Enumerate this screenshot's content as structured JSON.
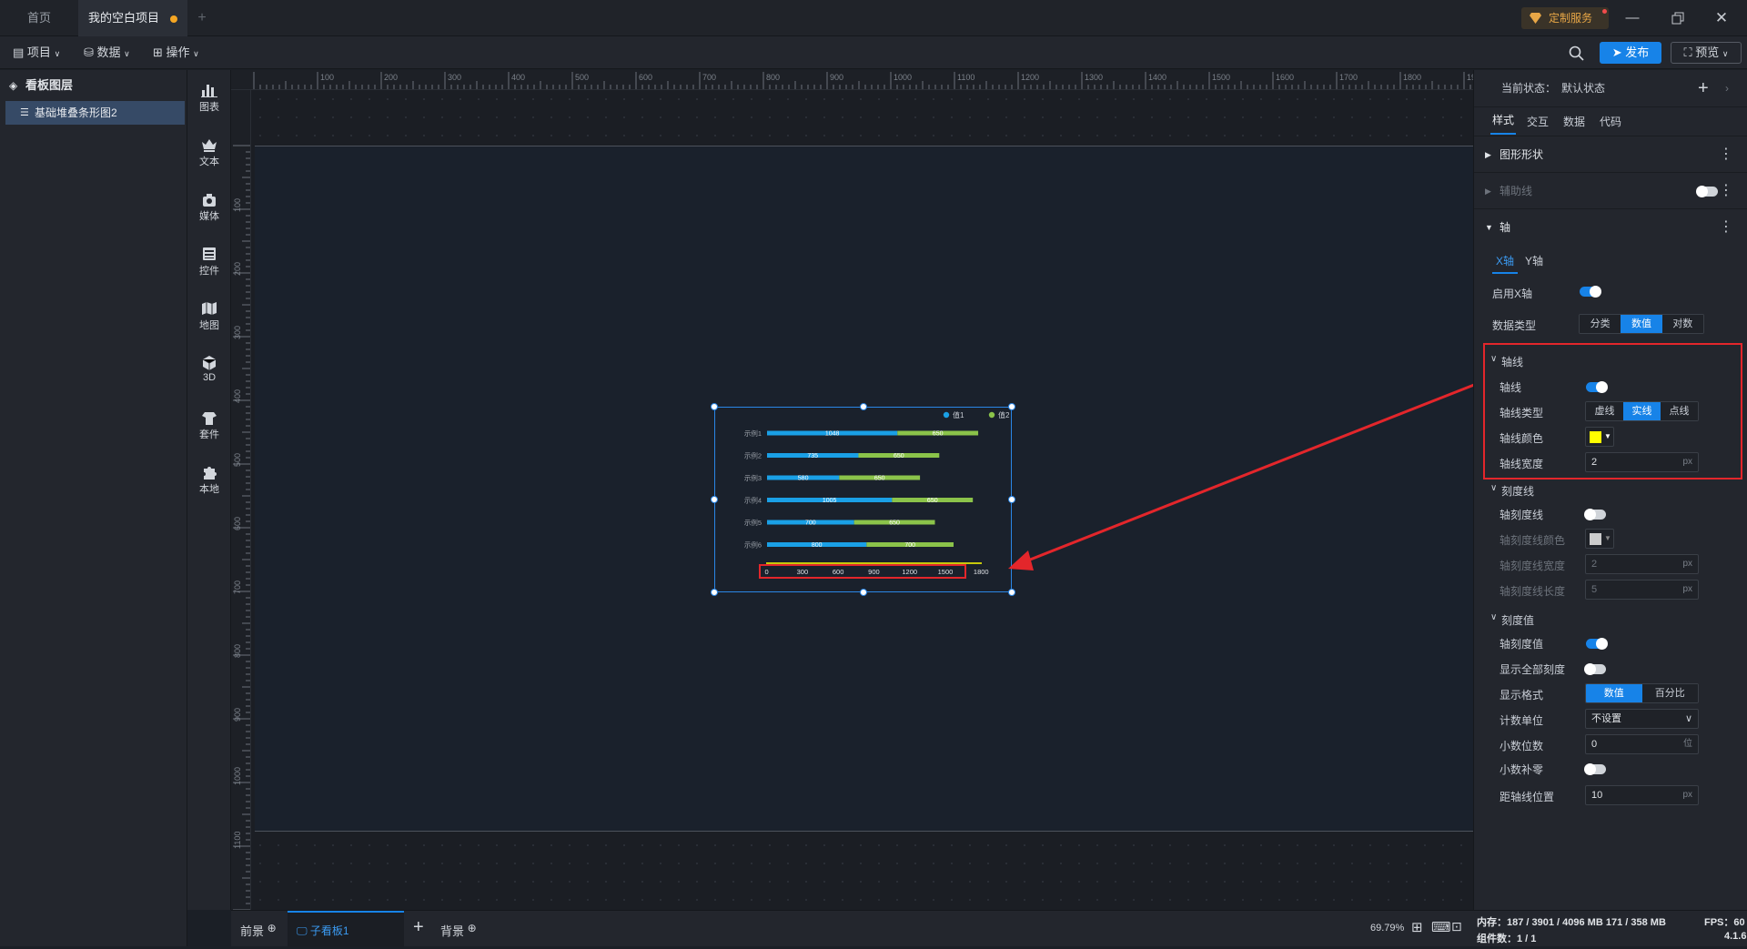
{
  "tabs": [
    {
      "label": "首页"
    },
    {
      "label": "我的空白项目"
    }
  ],
  "top_right": {
    "custom_service": "定制服务"
  },
  "toolbar": {
    "project": "项目",
    "data": "数据",
    "operate": "操作",
    "publish": "发布",
    "preview": "预览"
  },
  "layers": {
    "title": "看板图层",
    "items": [
      {
        "label": "基础堆叠条形图2"
      }
    ]
  },
  "tools": [
    {
      "label": "图表",
      "icon": "bar-chart-icon"
    },
    {
      "label": "文本",
      "icon": "text-icon"
    },
    {
      "label": "媒体",
      "icon": "media-icon"
    },
    {
      "label": "控件",
      "icon": "widget-icon"
    },
    {
      "label": "地图",
      "icon": "map-icon"
    },
    {
      "label": "3D",
      "icon": "cube-icon"
    },
    {
      "label": "套件",
      "icon": "kit-icon"
    },
    {
      "label": "本地",
      "icon": "puzzle-icon"
    }
  ],
  "ruler": {
    "top_ticks": [
      "100",
      "200",
      "300",
      "400",
      "500",
      "600",
      "700",
      "800",
      "900",
      "1000",
      "1100",
      "1200",
      "1300",
      "1400",
      "1500",
      "1600",
      "1700",
      "1800",
      "1900"
    ],
    "left_ticks": [
      "100",
      "200",
      "300",
      "400",
      "500",
      "600",
      "700",
      "800",
      "900",
      "1000",
      "1100"
    ]
  },
  "chart_data": {
    "type": "bar",
    "orientation": "horizontal",
    "stacked": true,
    "categories": [
      "示例1",
      "示例2",
      "示例3",
      "示例4",
      "示例5",
      "示例6"
    ],
    "series": [
      {
        "name": "值1",
        "color": "#1aa0e6",
        "values": [
          1048,
          735,
          580,
          1005,
          700,
          800
        ]
      },
      {
        "name": "值2",
        "color": "#8bc34a",
        "values": [
          650,
          650,
          650,
          650,
          650,
          700
        ]
      }
    ],
    "x_ticks": [
      "0",
      "300",
      "600",
      "900",
      "1200",
      "1500",
      "1800"
    ],
    "xlim": [
      0,
      1800
    ],
    "axis_line_color": "#ffff00",
    "legend": "top-right"
  },
  "props": {
    "state_label": "当前状态：",
    "state_value": "默认状态",
    "tabs": [
      "样式",
      "交互",
      "数据",
      "代码"
    ],
    "sections": {
      "shape": "图形形状",
      "guide": "辅助线",
      "axis": "轴"
    },
    "axis_tabs": [
      "X轴",
      "Y轴"
    ],
    "enable_x": "启用X轴",
    "data_type": "数据类型",
    "data_type_options": [
      "分类",
      "数值",
      "对数"
    ],
    "data_type_selected": "数值",
    "axisline": {
      "title": "轴线",
      "toggle_label": "轴线",
      "type_label": "轴线类型",
      "type_options": [
        "虚线",
        "实线",
        "点线"
      ],
      "type_selected": "实线",
      "color_label": "轴线颜色",
      "color": "#ffff00",
      "width_label": "轴线宽度",
      "width_value": "2",
      "unit": "px"
    },
    "tick": {
      "title": "刻度线",
      "toggle_label": "轴刻度线",
      "color_label": "轴刻度线颜色",
      "color": "#cccccc",
      "width_label": "轴刻度线宽度",
      "width_value": "2",
      "length_label": "轴刻度线长度",
      "length_value": "5",
      "unit": "px"
    },
    "tickvalue": {
      "title": "刻度值",
      "toggle_label": "轴刻度值",
      "show_all_label": "显示全部刻度",
      "format_label": "显示格式",
      "format_options": [
        "数值",
        "百分比"
      ],
      "format_selected": "数值",
      "unit_label": "计数单位",
      "unit_value": "不设置",
      "decimals_label": "小数位数",
      "decimals_value": "0",
      "decimals_unit": "位",
      "pad_zero_label": "小数补零",
      "distance_label": "距轴线位置",
      "distance_value": "10",
      "unit": "px"
    }
  },
  "bottom": {
    "front": "前景",
    "sub_board": "子看板1",
    "background": "背景",
    "zoom": "69.79%"
  },
  "status": {
    "memory": "内存：187 / 3901 / 4096 MB 171 / 358 MB",
    "fps": "FPS：60",
    "components": "组件数：1 / 1",
    "version": "4.1.6"
  }
}
